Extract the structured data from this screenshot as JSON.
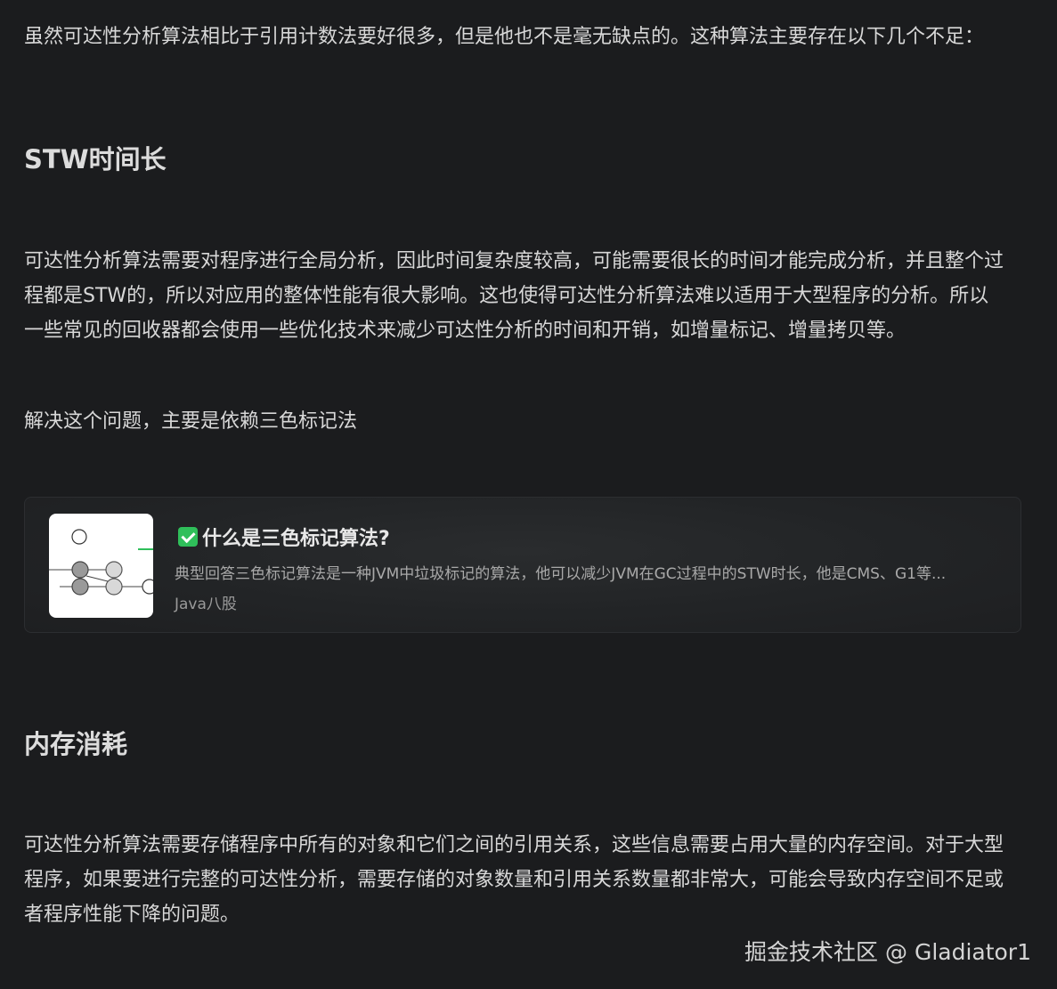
{
  "article": {
    "intro": "虽然可达性分析算法相比于引用计数法要好很多，但是他也不是毫无缺点的。这种算法主要存在以下几个不足：",
    "section1": {
      "heading": "STW时间长",
      "para1_line1": "可达性分析算法需要对程序进行全局分析，因此时间复杂度较高，可能需要很长的时间才能完成分析，并且整个过",
      "para1_line2": "程都是STW的，所以对应用的整体性能有很大影响。这也使得可达性分析算法难以适用于大型程序的分析。所以",
      "para1_line3": "一些常见的回收器都会使用一些优化技术来减少可达性分析的时间和开销，如增量标记、增量拷贝等。",
      "para2": "解决这个问题，主要是依赖三色标记法"
    },
    "link_card": {
      "title": "什么是三色标记算法?",
      "description": "典型回答三色标记算法是一种JVM中垃圾标记的算法，他可以减少JVM在GC过程中的STW时长，他是CMS、G1等...",
      "source": "Java八股",
      "title_icon": "check-icon",
      "accent_color": "#2fbf5a"
    },
    "section2": {
      "heading": "内存消耗",
      "para_line1": "可达性分析算法需要存储程序中所有的对象和它们之间的引用关系，这些信息需要占用大量的内存空间。对于大型",
      "para_line2": "程序，如果要进行完整的可达性分析，需要存储的对象数量和引用关系数量都非常大，可能会导致内存空间不足或",
      "para_line3": "者程序性能下降的问题。"
    }
  },
  "watermark": "掘金技术社区 @ Gladiator1",
  "colors": {
    "background": "#1b1c1e",
    "text": "#d8d8d8"
  }
}
